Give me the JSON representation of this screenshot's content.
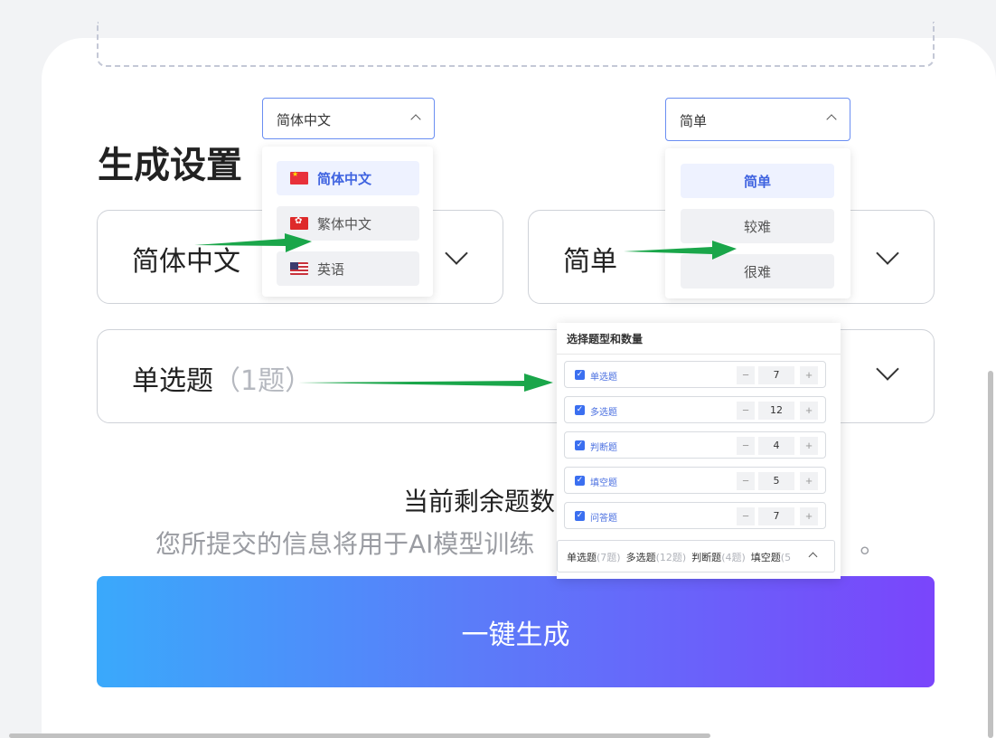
{
  "settings": {
    "title": "生成设置",
    "language_value": "简体中文",
    "difficulty_value": "简单",
    "question_type_value": "单选题",
    "question_type_count": "（1题）",
    "remaining_text": "当前剩余题数",
    "disclaimer": "您所提交的信息将用于AI模型训练",
    "disclaimer_tail": "。",
    "generate_label": "一键生成"
  },
  "language_popup": {
    "selected": "简体中文",
    "options": [
      {
        "label": "简体中文",
        "flag": "cn-flag-icon",
        "active": true
      },
      {
        "label": "繁体中文",
        "flag": "hk-flag-icon",
        "active": false
      },
      {
        "label": "英语",
        "flag": "us-flag-icon",
        "active": false
      }
    ]
  },
  "difficulty_popup": {
    "selected": "简单",
    "options": [
      {
        "label": "简单",
        "active": true
      },
      {
        "label": "较难",
        "active": false
      },
      {
        "label": "很难",
        "active": false
      }
    ]
  },
  "question_panel": {
    "title": "选择题型和数量",
    "rows": [
      {
        "label": "单选题",
        "count": "7",
        "checked": true
      },
      {
        "label": "多选题",
        "count": "12",
        "checked": true
      },
      {
        "label": "判断题",
        "count": "4",
        "checked": true
      },
      {
        "label": "填空题",
        "count": "5",
        "checked": true
      },
      {
        "label": "问答题",
        "count": "7",
        "checked": true
      }
    ],
    "minus": "−",
    "plus": "+",
    "summary": [
      {
        "label": "单选题",
        "count": "(7题)"
      },
      {
        "label": "多选题",
        "count": "(12题)"
      },
      {
        "label": "判断题",
        "count": "(4题)"
      },
      {
        "label": "填空题",
        "count": "(5"
      }
    ]
  },
  "colors": {
    "accent": "#3f63e0",
    "arrow": "#1aa64a",
    "gradient_start": "#3aa9fb",
    "gradient_end": "#7a45fb"
  }
}
